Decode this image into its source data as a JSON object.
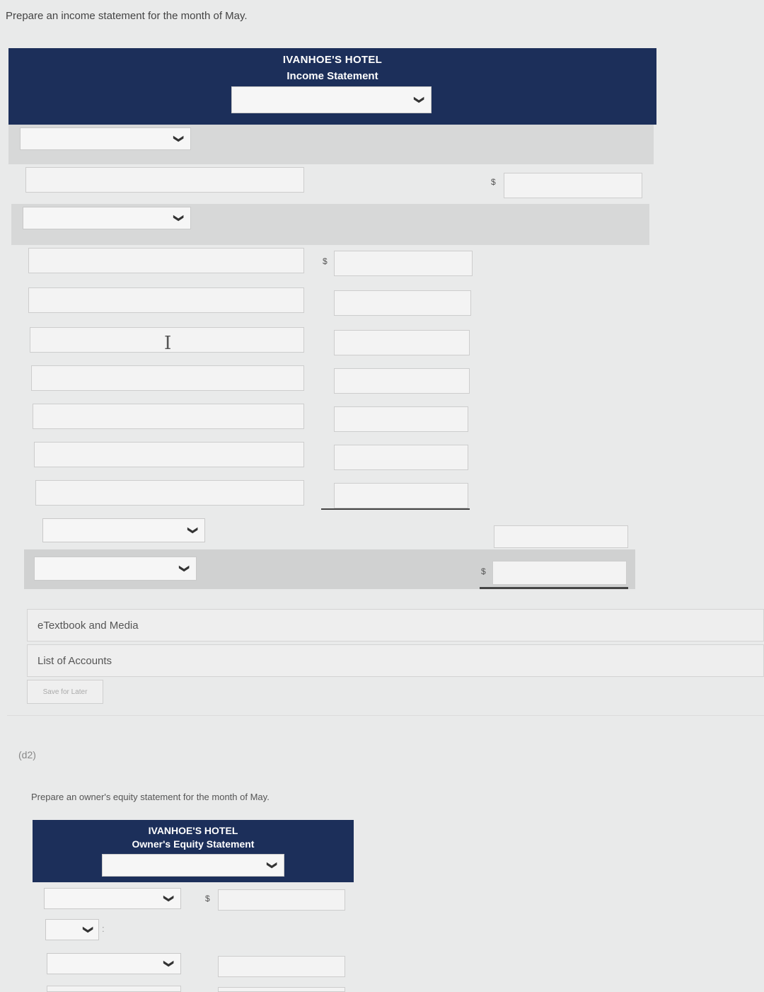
{
  "page": {
    "prompt": "Prepare an income statement for the month of May.",
    "part_label": "(d2)",
    "prompt2": "Prepare an owner's equity statement for the month of May."
  },
  "income_statement": {
    "company": "IVANHOE'S HOTEL",
    "title": "Income Statement",
    "period_select": "",
    "currency": "$"
  },
  "equity_statement": {
    "company": "IVANHOE'S HOTEL",
    "title": "Owner's Equity Statement",
    "period_select": "",
    "currency": "$",
    "operator": ":"
  },
  "links": {
    "etextbook": "eTextbook and Media",
    "accounts": "List of Accounts",
    "save": "Save for Later"
  },
  "icons": {
    "chevron": "❯",
    "dropdown": "chevron-down-icon"
  }
}
